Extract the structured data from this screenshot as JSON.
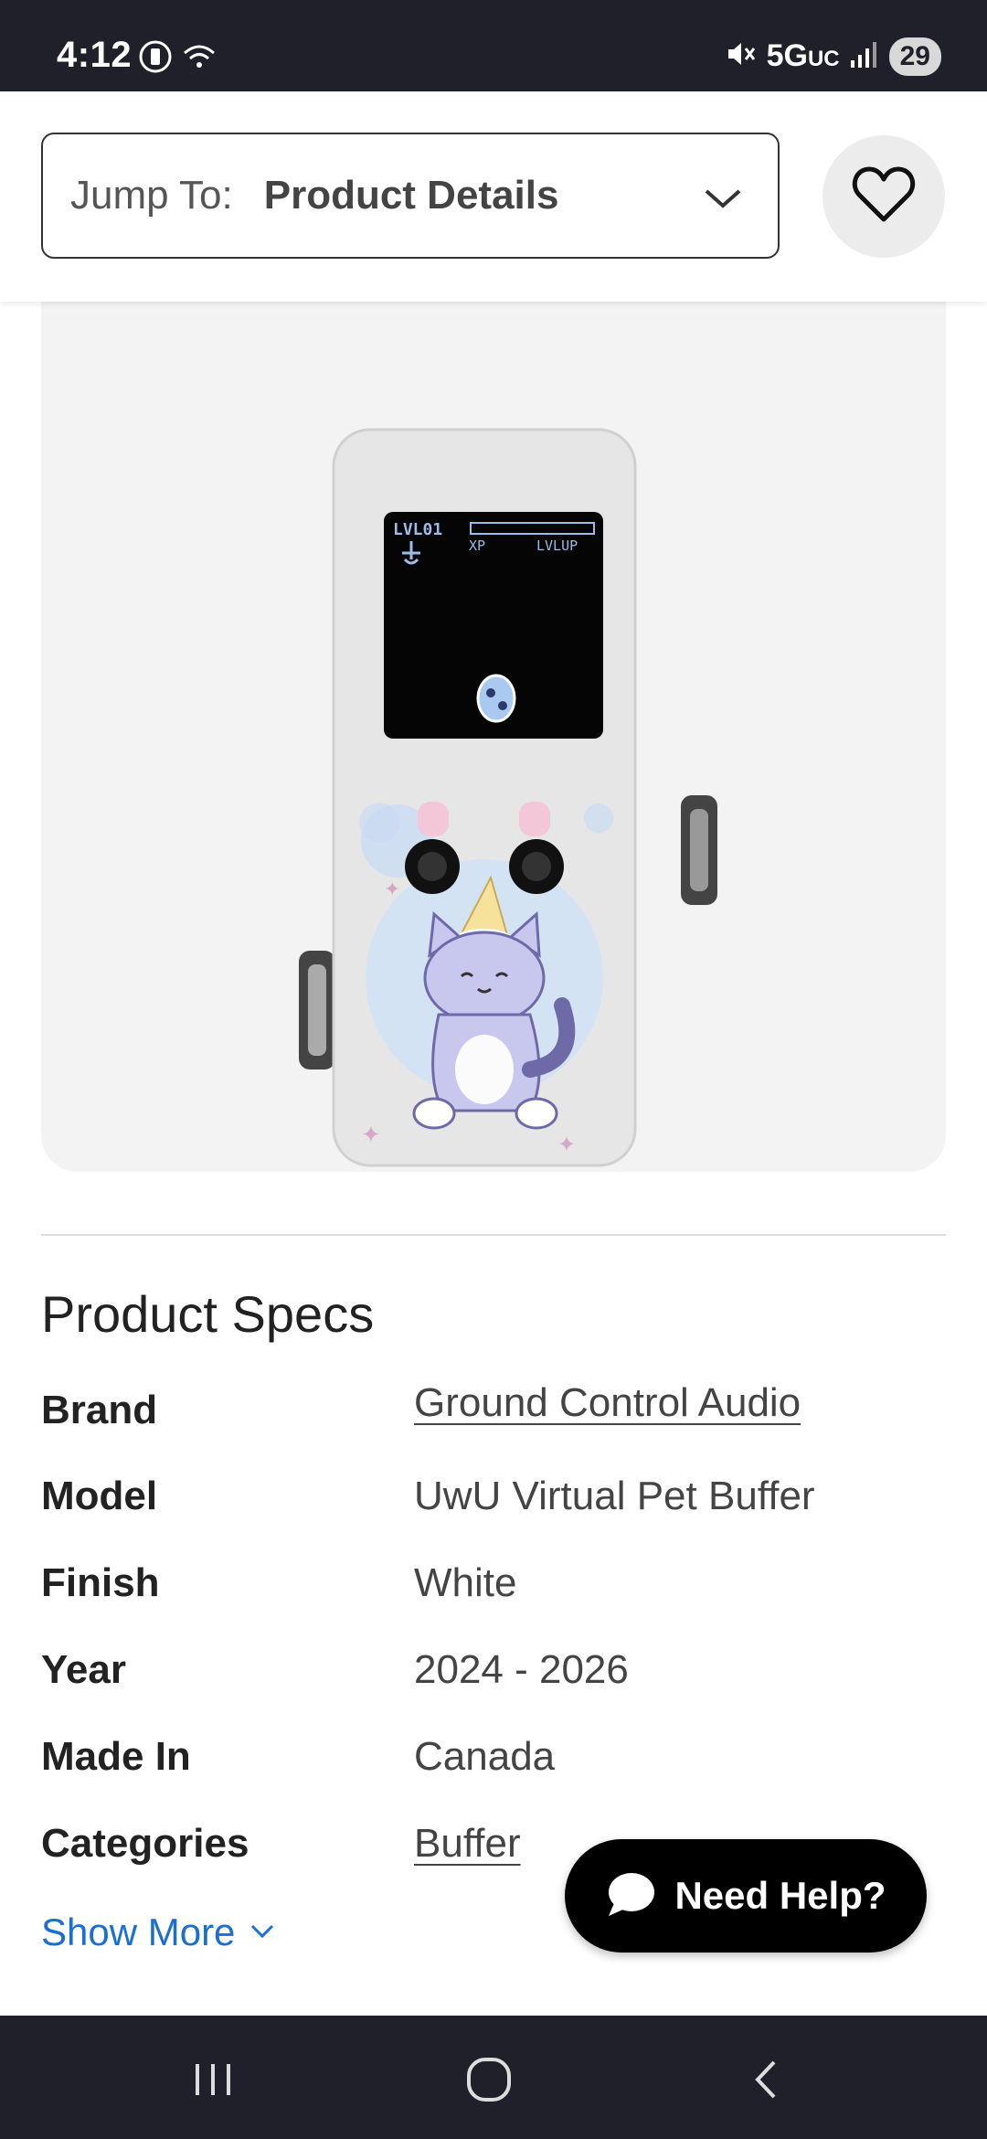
{
  "status_bar": {
    "time": "4:12",
    "network": "5G",
    "network_suffix": "UC",
    "battery": "29"
  },
  "jump_bar": {
    "label": "Jump To:",
    "selected": "Product Details"
  },
  "product_image": {
    "screen_text": {
      "level": "LVL01",
      "xp": "XP",
      "lvlup": "LVLUP"
    }
  },
  "specs": {
    "title": "Product Specs",
    "rows": [
      {
        "label": "Brand",
        "value": "Ground Control Audio",
        "link": true
      },
      {
        "label": "Model",
        "value": "UwU Virtual Pet Buffer",
        "link": false
      },
      {
        "label": "Finish",
        "value": "White",
        "link": false
      },
      {
        "label": "Year",
        "value": "2024 - 2026",
        "link": false
      },
      {
        "label": "Made In",
        "value": "Canada",
        "link": false
      },
      {
        "label": "Categories",
        "value": "Buffer",
        "link": true
      }
    ],
    "show_more": "Show More"
  },
  "help": {
    "label": "Need Help?"
  },
  "colors": {
    "status_bar_bg": "#1f2029",
    "link_blue": "#1a6fd0",
    "help_bg": "#000000"
  }
}
